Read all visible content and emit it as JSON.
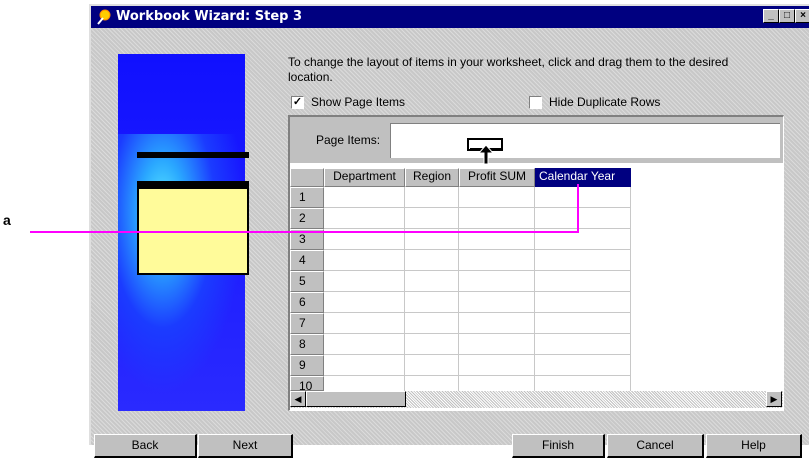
{
  "window": {
    "title": "Workbook Wizard: Step 3",
    "controls": {
      "minimize": "_",
      "maximize": "□",
      "close": "×"
    }
  },
  "instructions": "To change the layout of items in your worksheet, click and drag them to the desired location.",
  "options": {
    "show_page_items": {
      "label": "Show Page Items",
      "checked": true
    },
    "hide_duplicate_rows": {
      "label": "Hide Duplicate Rows",
      "checked": false
    }
  },
  "page_items": {
    "label": "Page Items:"
  },
  "grid": {
    "columns": [
      "Department",
      "Region",
      "Profit SUM",
      "Calendar Year"
    ],
    "selected_column": "Calendar Year",
    "rows": [
      "1",
      "2",
      "3",
      "4",
      "5",
      "6",
      "7",
      "8",
      "9",
      "10"
    ]
  },
  "buttons": {
    "back": "Back",
    "next": "Next",
    "finish": "Finish",
    "cancel": "Cancel",
    "help": "Help"
  },
  "callout": {
    "label": "a"
  },
  "colors": {
    "accent": "#000080",
    "callout": "#ff00ff",
    "graphic_blue": "#1010ff"
  },
  "icons": {
    "title": "wizard-icon",
    "drag_cursor": "drag-cursor-icon",
    "scroll_left": "arrow-left-icon",
    "scroll_right": "arrow-right-icon"
  }
}
